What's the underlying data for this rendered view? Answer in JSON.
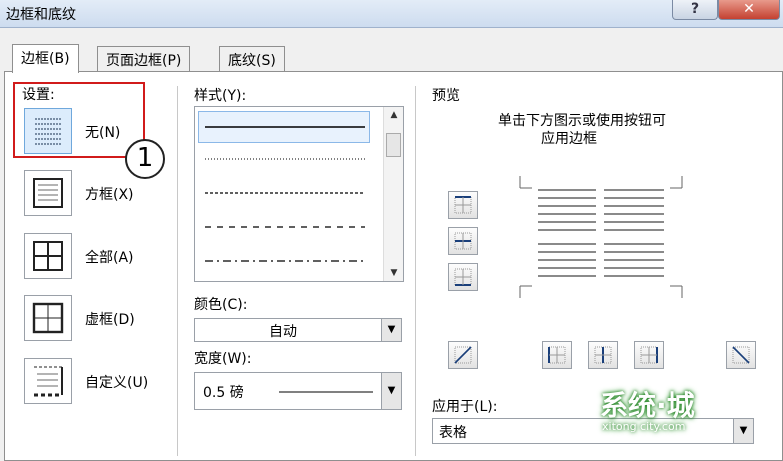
{
  "window": {
    "title": "边框和底纹",
    "help_label": "?",
    "close_label": "✕"
  },
  "tabs": [
    {
      "label": "边框(B)",
      "active": true
    },
    {
      "label": "页面边框(P)",
      "active": false
    },
    {
      "label": "底纹(S)",
      "active": false
    }
  ],
  "settings": {
    "label": "设置:",
    "items": [
      {
        "label": "无(N)",
        "selected": true
      },
      {
        "label": "方框(X)"
      },
      {
        "label": "全部(A)"
      },
      {
        "label": "虚框(D)"
      },
      {
        "label": "自定义(U)"
      }
    ],
    "callout_number": "1"
  },
  "style": {
    "label": "样式(Y):"
  },
  "color": {
    "label": "颜色(C):",
    "value": "自动"
  },
  "width": {
    "label": "宽度(W):",
    "value": "0.5 磅"
  },
  "preview": {
    "label": "预览",
    "hint_line1": "单击下方图示或使用按钮可",
    "hint_line2": "应用边框"
  },
  "apply_to": {
    "label": "应用于(L):",
    "value": "表格"
  },
  "watermark": {
    "text": "系统·城",
    "sub": "xitong city.com"
  },
  "colors": {
    "highlight_red": "#d11b1b",
    "selection_blue": "#dcecfc"
  }
}
